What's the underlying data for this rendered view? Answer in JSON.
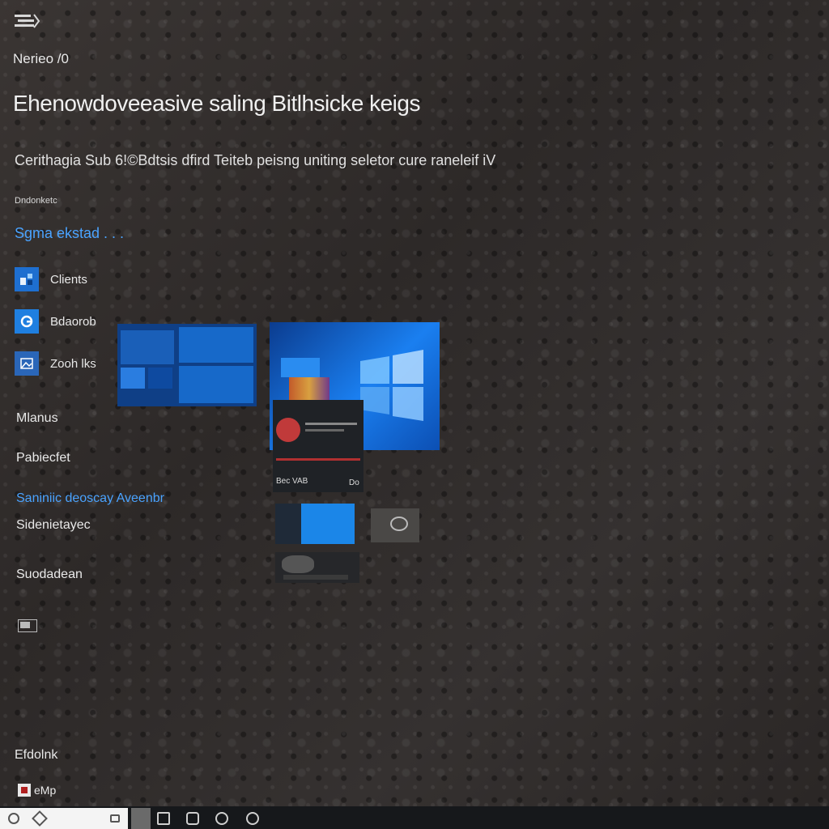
{
  "header": {
    "app_label": "Nerieo /0",
    "title": "Ehenowdoveeasive saling Bitlhsicke keigs",
    "subtitle": "Cerithagia Sub 6!©Bdtsis dfird Teiteb peisng uniting seletor cure raneleif iV"
  },
  "section": {
    "small_label": "Dndonketc",
    "link": "Sgma ekstad . . ."
  },
  "apps": [
    {
      "label": "Clients",
      "icon": "app-grid-icon"
    },
    {
      "label": "Bdaorob",
      "icon": "edge-icon"
    },
    {
      "label": "Zooh lks",
      "icon": "photos-icon"
    }
  ],
  "menu": {
    "item1": "Mlanus",
    "item2": "Pabiecfet",
    "link2": "Saniniic deoscay Aveenbr",
    "item3": "Sidenietayec",
    "item4": "Suodadean",
    "footer": "Efdolnk",
    "footer_user": "eMp"
  },
  "preview": {
    "window_label": "Bec VAB",
    "window_label_right": "Do"
  },
  "colors": {
    "accent": "#1769c9",
    "link": "#4aa3ff",
    "background": "#2f2b2a"
  }
}
